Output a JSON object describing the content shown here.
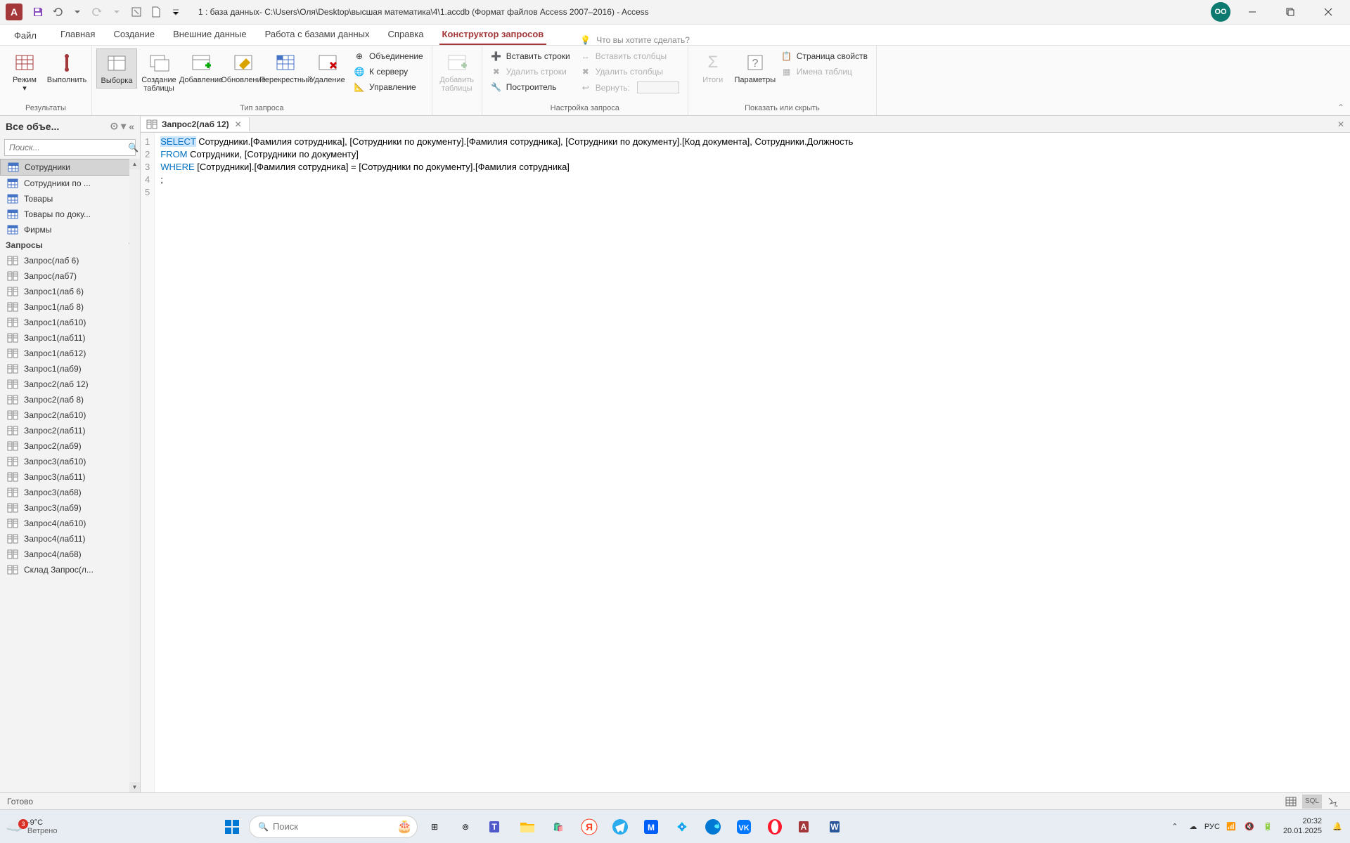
{
  "titlebar": {
    "app_logo": "A",
    "title": "1 : база данных- C:\\Users\\Оля\\Desktop\\высшая математика\\4\\1.accdb  (Формат файлов Access 2007–2016)  -  Access",
    "user_initials": "ОО"
  },
  "ribbon": {
    "tabs": {
      "file": "Файл",
      "home": "Главная",
      "create": "Создание",
      "external": "Внешние данные",
      "dbtools": "Работа с базами данных",
      "help": "Справка",
      "querydesign": "Конструктор запросов"
    },
    "tellme_placeholder": "Что вы хотите сделать?",
    "groups": {
      "results": {
        "label": "Результаты",
        "view": "Режим",
        "run": "Выполнить"
      },
      "querytype": {
        "label": "Тип запроса",
        "select": "Выборка",
        "maketable": "Создание таблицы",
        "append": "Добавление",
        "update": "Обновление",
        "crosstab": "Перекрестный",
        "delete": "Удаление",
        "union": "Объединение",
        "passthrough": "К серверу",
        "ddl": "Управление"
      },
      "addtables": "Добавить таблицы",
      "querysetup": {
        "label": "Настройка запроса",
        "insertrows": "Вставить строки",
        "deleterows": "Удалить строки",
        "builder": "Построитель",
        "insertcols": "Вставить столбцы",
        "deletecols": "Удалить столбцы",
        "return": "Вернуть:"
      },
      "showhide": {
        "label": "Показать или скрыть",
        "totals": "Итоги",
        "params": "Параметры",
        "propsheet": "Страница свойств",
        "tablenames": "Имена таблиц"
      }
    }
  },
  "navpane": {
    "header": "Все объе...",
    "search_placeholder": "Поиск...",
    "tables": [
      "Сотрудники",
      "Сотрудники по ...",
      "Товары",
      "Товары по доку...",
      "Фирмы"
    ],
    "queries_label": "Запросы",
    "queries": [
      "Запрос(лаб 6)",
      "Запрос(лаб7)",
      "Запрос1(лаб 6)",
      "Запрос1(лаб 8)",
      "Запрос1(лаб10)",
      "Запрос1(лаб11)",
      "Запрос1(лаб12)",
      "Запрос1(лаб9)",
      "Запрос2(лаб 12)",
      "Запрос2(лаб 8)",
      "Запрос2(лаб10)",
      "Запрос2(лаб11)",
      "Запрос2(лаб9)",
      "Запрос3(лаб10)",
      "Запрос3(лаб11)",
      "Запрос3(лаб8)",
      "Запрос3(лаб9)",
      "Запрос4(лаб10)",
      "Запрос4(лаб11)",
      "Запрос4(лаб8)",
      "Склад Запрос(л..."
    ]
  },
  "document": {
    "tab_name": "Запрос2(лаб 12)",
    "sql": {
      "line1_kw": "SELECT",
      "line1_rest": " Сотрудники.[Фамилия сотрудника], [Сотрудники по документу].[Фамилия сотрудника], [Сотрудники по документу].[Код документа], Сотрудники.Должность",
      "line2_kw": "FROM",
      "line2_rest": " Сотрудники, [Сотрудники по документу]",
      "line3_kw": "WHERE",
      "line3_rest": " [Сотрудники].[Фамилия сотрудника] = [Сотрудники по документу].[Фамилия сотрудника]",
      "line4": ";",
      "line5": ""
    }
  },
  "status": {
    "ready": "Готово",
    "sql": "SQL"
  },
  "taskbar": {
    "weather_temp": "-9°C",
    "weather_cond": "Ветрено",
    "weather_badge": "3",
    "search_placeholder": "Поиск",
    "lang": "РУС",
    "time": "20:32",
    "date": "20.01.2025"
  }
}
